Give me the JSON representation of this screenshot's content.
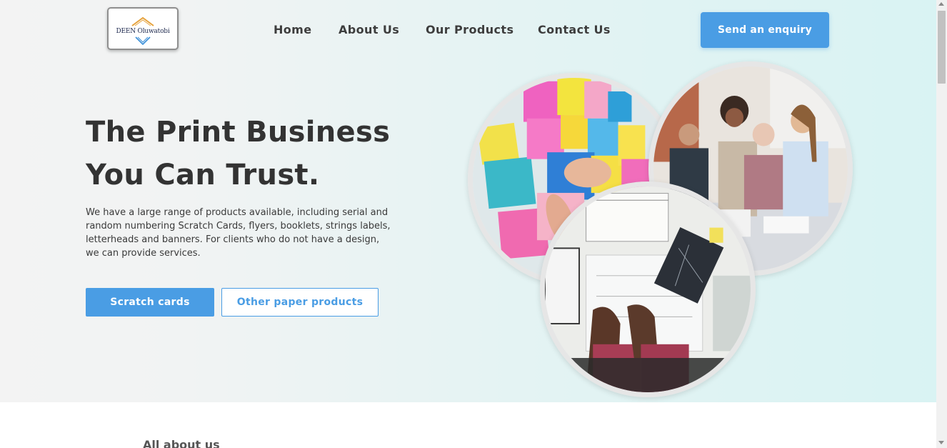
{
  "brand": {
    "logo_text": "DEEN Oluwatobi"
  },
  "nav": {
    "items": [
      "Home",
      "About Us",
      "Our Products",
      "Contact Us"
    ],
    "cta": "Send an enquiry"
  },
  "hero": {
    "headline_line1": "The Print Business",
    "headline_line2": "You Can Trust.",
    "description": "We have a large range of products available, including serial and random numbering Scratch Cards, flyers, booklets, strings labels, letterheads and banners. For clients who do not have a design, we can provide services.",
    "primary_button": "Scratch cards",
    "secondary_button": "Other paper products"
  },
  "next_section": {
    "title": "All about us"
  },
  "colors": {
    "accent": "#4a9de4",
    "text": "#333333",
    "hero_bg": "#d9f3f3"
  }
}
